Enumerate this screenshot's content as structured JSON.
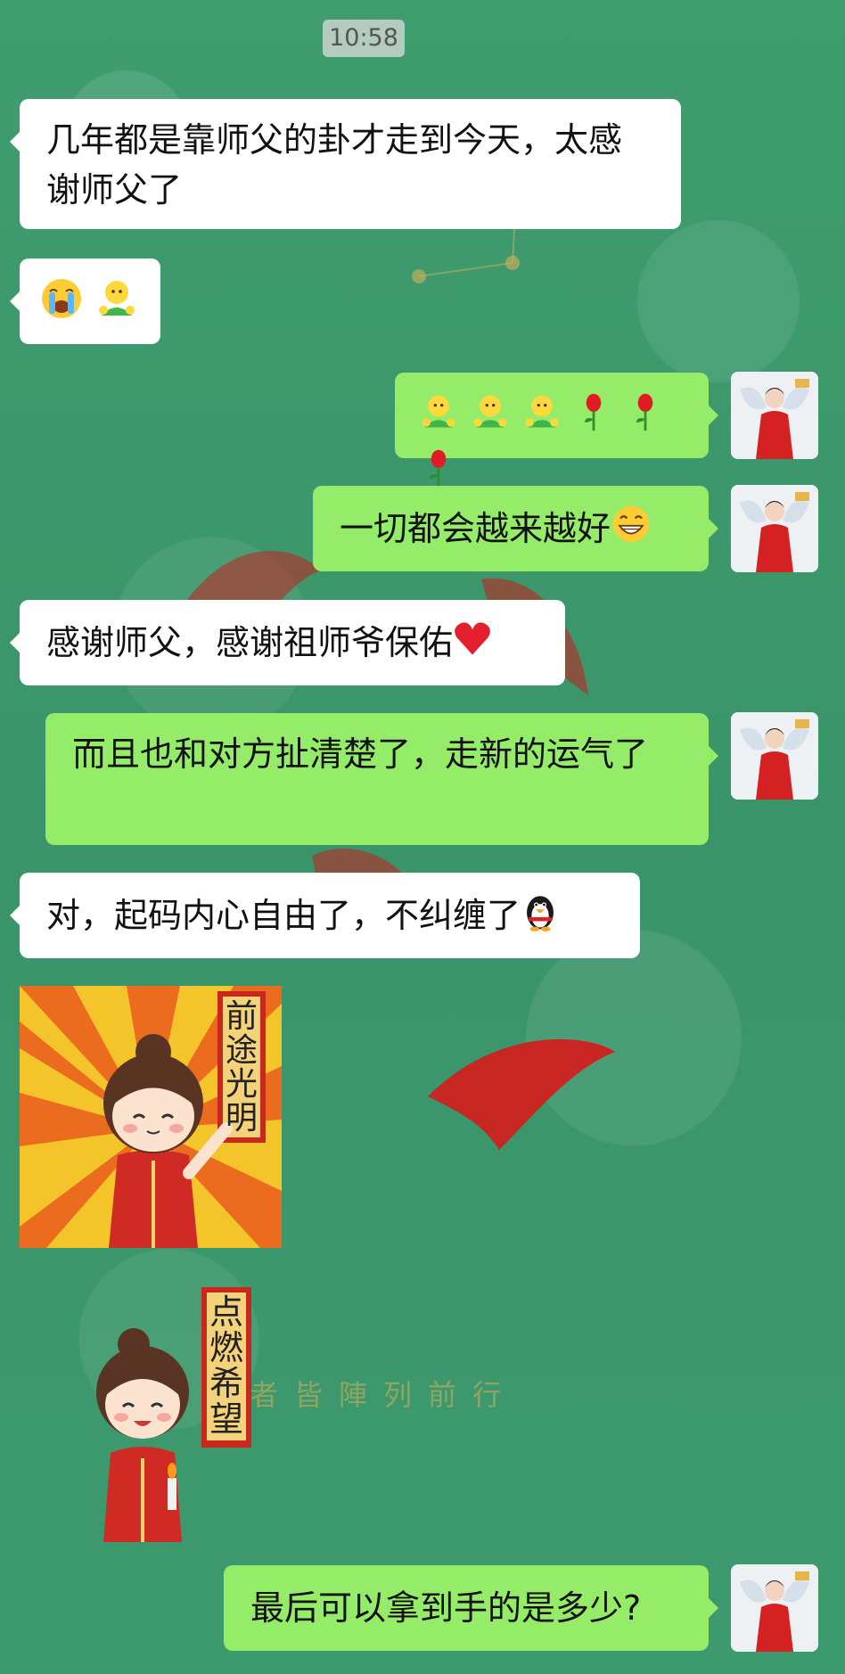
{
  "status": {
    "time": "10:58"
  },
  "messages": [
    {
      "side": "left",
      "text": "几年都是靠师父的卦才走到今天，太感谢师父了"
    },
    {
      "side": "left",
      "emojis": [
        "loudly-crying-face",
        "shrug-man"
      ]
    },
    {
      "side": "right",
      "emojis": [
        "shrug-man",
        "shrug-man",
        "shrug-man",
        "rose",
        "rose",
        "rose"
      ]
    },
    {
      "side": "right",
      "text": "一切都会越来越好",
      "emoji": "grinning-face"
    },
    {
      "side": "left",
      "text": "感谢师父，感谢祖师爷保佑",
      "emoji": "red-heart"
    },
    {
      "side": "right",
      "text": "而且也和对方扯清楚了，走新的运气了"
    },
    {
      "side": "left",
      "text": "对，起码内心自由了，不纠缠了",
      "emoji": "penguin"
    },
    {
      "side": "left",
      "sticker": "前途光明"
    },
    {
      "side": "left",
      "sticker": "点燃希望"
    },
    {
      "side": "right",
      "text": "最后可以拿到手的是多少?"
    }
  ],
  "colors": {
    "background": "#3e9a6c",
    "self_bubble": "#95ec69",
    "other_bubble": "#ffffff"
  }
}
